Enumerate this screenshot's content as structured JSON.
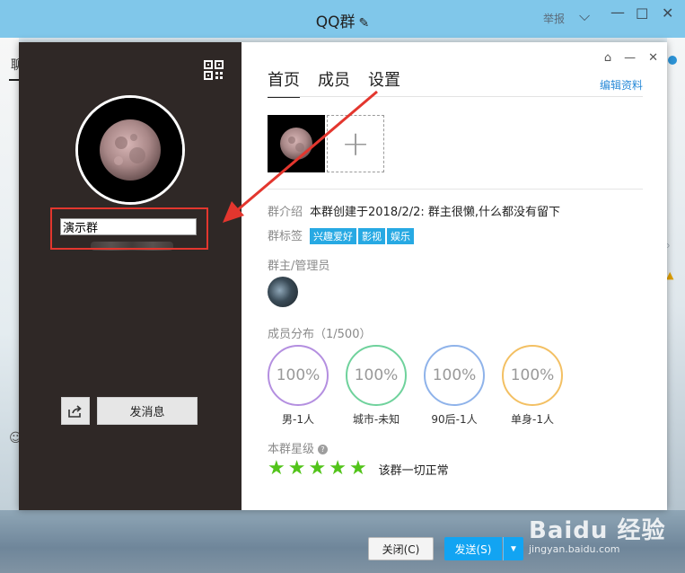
{
  "window": {
    "title": "QQ群",
    "report_label": "举报",
    "left_tab_label": "聊",
    "close_label": "关闭(C)",
    "send_label": "发送(S)"
  },
  "watermark": {
    "main": "Baidu 经验",
    "sub": "jingyan.baidu.com"
  },
  "dialog": {
    "group_name_value": "演示群",
    "send_message_label": "发消息",
    "tabs": [
      {
        "label": "首页",
        "active": true
      },
      {
        "label": "成员",
        "active": false
      },
      {
        "label": "设置",
        "active": false
      }
    ],
    "edit_profile_label": "编辑资料",
    "intro_label": "群介绍",
    "intro_text": "本群创建于2018/2/2:  群主很懒,什么都没有留下",
    "tags_label": "群标签",
    "tags": [
      "兴趣爱好",
      "影视",
      "娱乐"
    ],
    "admins_label": "群主/管理员",
    "distribution_label": "成员分布（1/500）",
    "distribution": [
      {
        "percent": "100%",
        "label": "男-1人",
        "color": "#b48fe0"
      },
      {
        "percent": "100%",
        "label": "城市-未知",
        "color": "#6fd29c"
      },
      {
        "percent": "100%",
        "label": "90后-1人",
        "color": "#8fb3ea"
      },
      {
        "percent": "100%",
        "label": "单身-1人",
        "color": "#f3c063"
      }
    ],
    "rating_label": "本群星级",
    "rating_stars": 5,
    "rating_text": "该群一切正常"
  },
  "colors": {
    "annotation": "#e3362e",
    "accent": "#12a4f2",
    "star": "#52c41a"
  }
}
